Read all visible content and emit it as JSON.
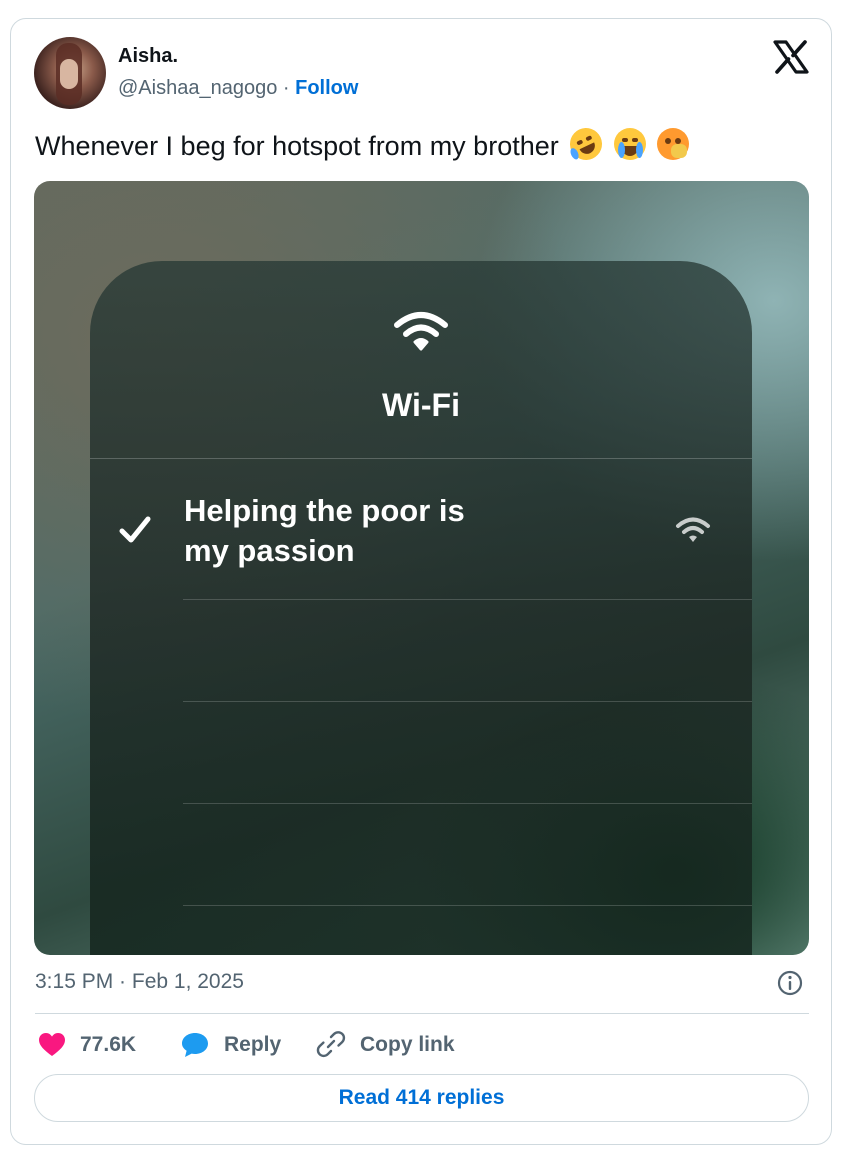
{
  "author": {
    "name": "Aisha.",
    "handle": "@Aishaa_nagogo",
    "separator": " · ",
    "follow_label": "Follow"
  },
  "brand_icon": "x-logo-icon",
  "tweet": {
    "text": "Whenever I beg for hotspot from my brother",
    "emojis": [
      "rolling-on-floor-laughing",
      "loudly-crying-face",
      "face-with-open-eyes-and-hand-over-mouth"
    ]
  },
  "media": {
    "panel_title": "Wi-Fi",
    "network_name": "Helping the poor is my passion",
    "network_connected": true
  },
  "meta": {
    "timestamp": "3:15 PM · Feb 1, 2025"
  },
  "actions": {
    "like_count": "77.6K",
    "reply_label": "Reply",
    "copy_link_label": "Copy link"
  },
  "read_replies_label": "Read 414 replies",
  "colors": {
    "link_blue": "#006fd6",
    "like_pink": "#f91880",
    "reply_blue": "#1d9bf0",
    "muted": "#536471"
  }
}
